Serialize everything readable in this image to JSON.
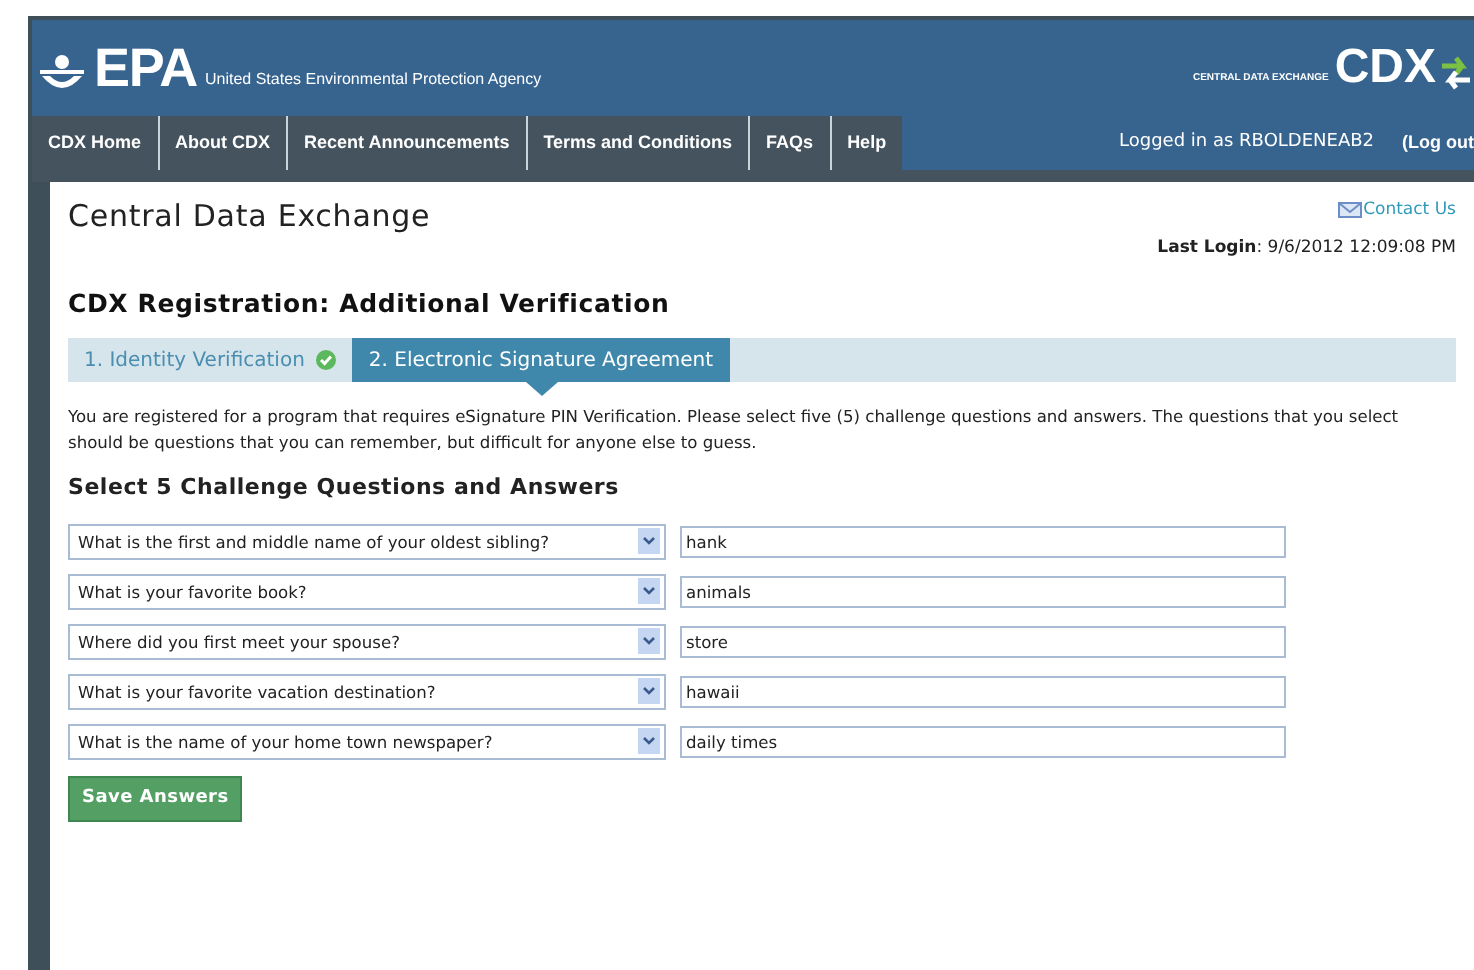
{
  "header": {
    "logo": "EPA",
    "agency": "United States Environmental Protection Agency",
    "cdx_tagline": "CENTRAL DATA EXCHANGE",
    "cdx_logo": "CDX"
  },
  "nav": {
    "items": [
      "CDX Home",
      "About CDX",
      "Recent Announcements",
      "Terms and Conditions",
      "FAQs",
      "Help"
    ],
    "logged_in": "Logged in as RBOLDENEAB2",
    "logout": "(Log out"
  },
  "page": {
    "title": "Central Data Exchange",
    "contact": "Contact Us",
    "last_login_label": "Last Login",
    "last_login_value": ": 9/6/2012 12:09:08 PM"
  },
  "registration": {
    "heading": "CDX Registration: Additional Verification",
    "steps": [
      {
        "label": "1. Identity Verification",
        "selected": false,
        "complete": true
      },
      {
        "label": "2. Electronic Signature Agreement",
        "selected": true,
        "complete": false
      }
    ],
    "intro": "You are registered for a program that requires eSignature PIN Verification. Please select five (5) challenge questions and answers. The questions that you select should be questions that you can remember, but difficult for anyone else to guess.",
    "section_title": "Select 5 Challenge Questions and Answers",
    "questions": [
      {
        "question": "What is the first and middle name of your oldest sibling?",
        "answer": "hank"
      },
      {
        "question": "What is your favorite book?",
        "answer": "animals"
      },
      {
        "question": "Where did you first meet your spouse?",
        "answer": "store"
      },
      {
        "question": "What is your favorite vacation destination?",
        "answer": "hawaii"
      },
      {
        "question": "What is the name of your home town newspaper?",
        "answer": "daily times"
      }
    ],
    "save_button": "Save Answers"
  }
}
